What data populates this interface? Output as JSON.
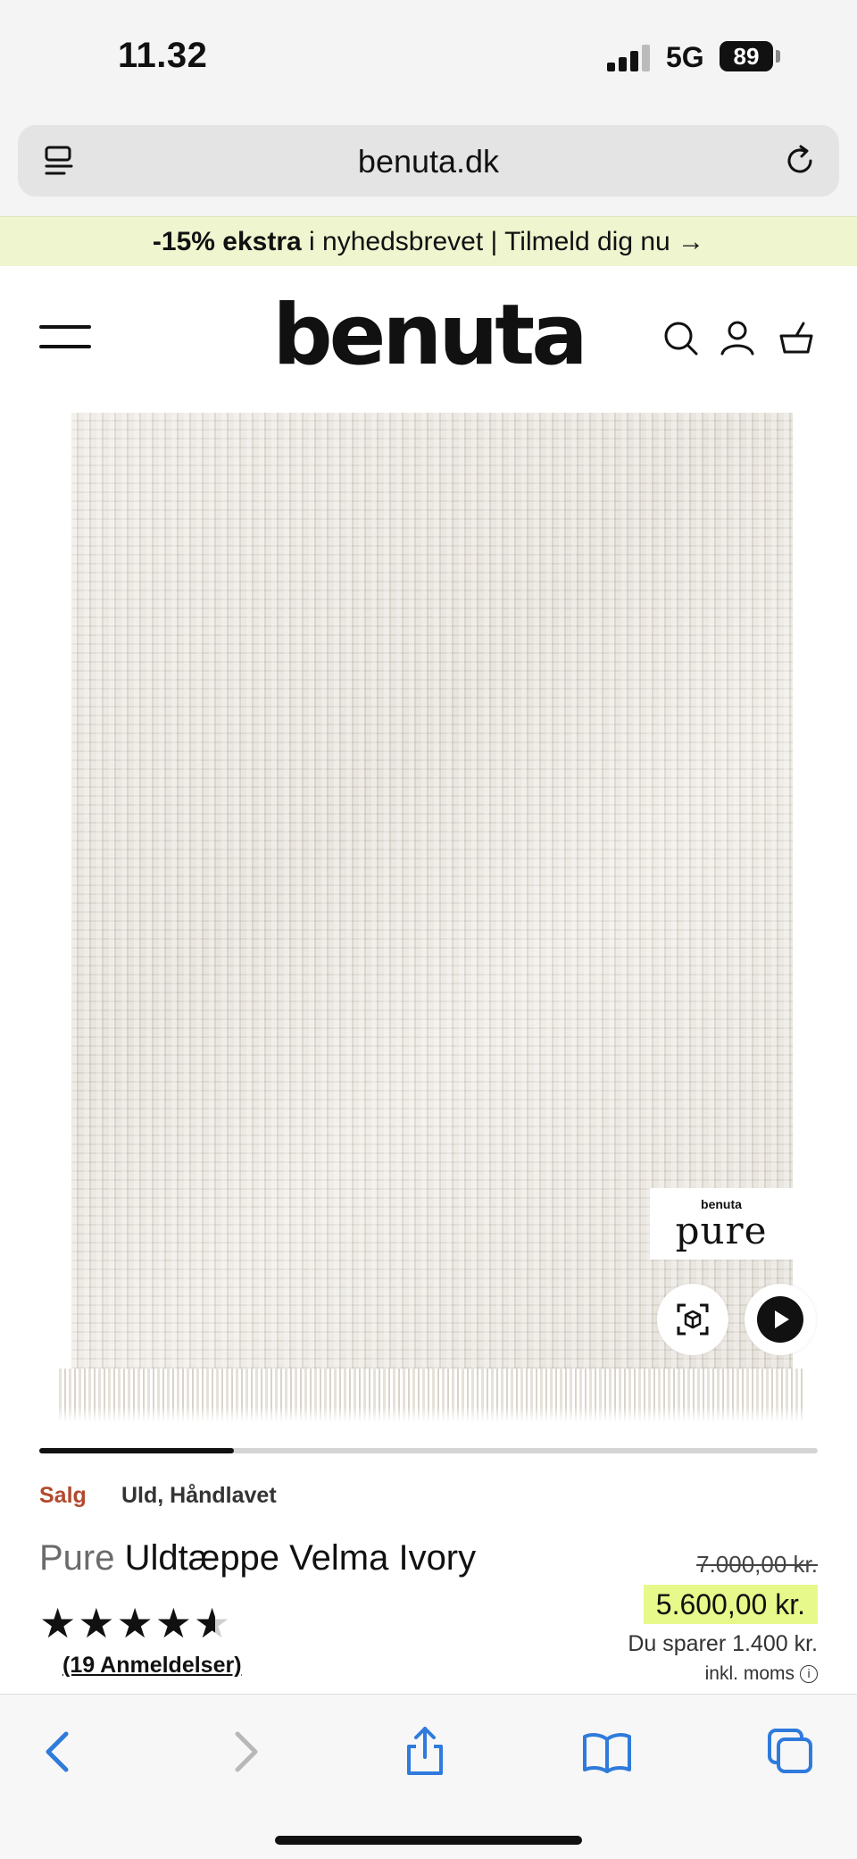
{
  "status_bar": {
    "time": "11.32",
    "network": "5G",
    "battery": "89"
  },
  "browser": {
    "url": "benuta.dk"
  },
  "promo": {
    "bold": "-15% ekstra",
    "text": " i nyhedsbrevet | Tilmeld dig nu  →"
  },
  "header": {
    "logo": "benuta"
  },
  "product_image": {
    "badge_small": "benuta",
    "badge_big": "pure",
    "carousel_progress": 0.25
  },
  "product": {
    "tag_sale": "Salg",
    "tag_attributes": "Uld, Håndlavet",
    "brand": "Pure",
    "name": " Uldtæppe Velma Ivory",
    "rating_stars": "★★★★",
    "rating_half_star": "★",
    "rating_value": 4.5,
    "reviews": "(19 Anmeldelser)",
    "price_old": "7.000,00 kr.",
    "price_new": "5.600,00 kr.",
    "savings": "Du sparer 1.400 kr.",
    "vat": "inkl. moms",
    "vat_info_icon": "i"
  },
  "colors": {
    "accent_price": "#e6f98a",
    "promo_bg": "#eef5cf",
    "sale_tag": "#b24a2f",
    "ios_blue": "#2f7bdc"
  }
}
